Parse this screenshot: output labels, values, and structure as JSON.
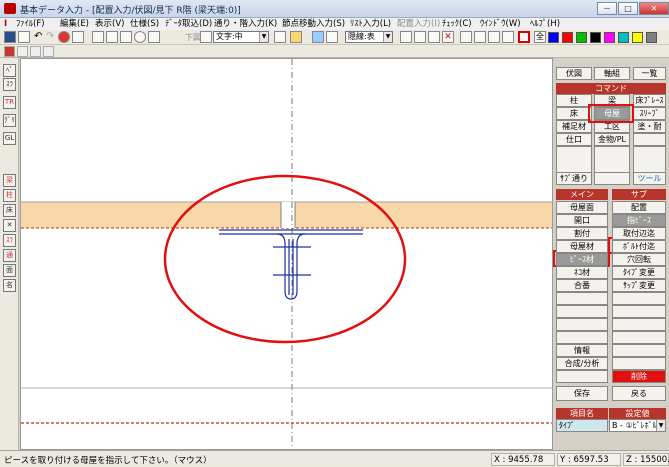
{
  "window": {
    "title": "基本データ入力 - [配置入力/伏図/見下 R階 (梁天端:0)]",
    "min": "－",
    "max": "□",
    "close": "✕"
  },
  "menu": [
    {
      "label": "ﾌｧｲﾙ(F)",
      "enabled": true
    },
    {
      "label": "編集(E)",
      "enabled": true
    },
    {
      "label": "表示(V)",
      "enabled": true
    },
    {
      "label": "仕様(S)",
      "enabled": true
    },
    {
      "label": "ﾃﾞｰﾀ取込(D)",
      "enabled": true
    },
    {
      "label": "通り・階入力(K)",
      "enabled": true
    },
    {
      "label": "節点移動入力(S)",
      "enabled": true
    },
    {
      "label": "ﾘｽﾄ入力(L)",
      "enabled": true
    },
    {
      "label": "配置入力(I)",
      "enabled": false
    },
    {
      "label": "ﾁｪｯｸ(C)",
      "enabled": true
    },
    {
      "label": "ｳｲﾝﾄﾞｳ(W)",
      "enabled": true
    },
    {
      "label": "ﾍﾙﾌﾟ(H)",
      "enabled": true
    }
  ],
  "toolbar": {
    "level_label": "下図",
    "text_size": "文字:中",
    "hidden_line": "隠線:表",
    "all_label": "全",
    "swatches": [
      "#0000ff",
      "#ff0000",
      "#00c000",
      "#000000",
      "#ff00ff",
      "#00c0c0",
      "#ffff00",
      "#808080"
    ]
  },
  "left_tools": [
    "ﾍﾟ",
    "ｽﾗ",
    "TR",
    "ｸﾞﾘ",
    "GL",
    "梁",
    "柱",
    "床",
    "✕",
    "ｽﾗ",
    "通",
    "面",
    "名"
  ],
  "right_panel": {
    "top_tabs": [
      "伏図",
      "軸組",
      "一覧"
    ],
    "command_header": "コマンド",
    "commands": [
      [
        "柱",
        "梁",
        "床ﾌﾞﾚｰｽ"
      ],
      [
        "床",
        "母屋",
        "ｽﾘｰﾌﾞ"
      ],
      [
        "補足材",
        "工区",
        "塗・耐"
      ],
      [
        "仕口",
        "金物/PL",
        ""
      ],
      [
        "",
        "",
        ""
      ],
      [
        "ｻﾌﾞ通り",
        "",
        "ツール"
      ]
    ],
    "main_header": "メイン",
    "sub_header": "サブ",
    "main_items": [
      "母屋面",
      "開口",
      "割付",
      "母屋材",
      "ﾋﾟｰｽ材",
      "ﾈｺ材",
      "合番",
      "",
      "",
      "",
      "",
      "情報",
      "合成/分析",
      ""
    ],
    "sub_items": [
      "配置",
      "指ﾋﾟｰｽ",
      "取付辺迄",
      "ﾎﾞﾙﾄ付迄",
      "穴回転",
      "ﾀｲﾌﾟ変更",
      "ｻｯﾌﾟ変更",
      "",
      "",
      "",
      "",
      "",
      "",
      "削除"
    ],
    "save": "保存",
    "back": "戻る",
    "prop_headers": [
      "項目名",
      "設定値"
    ],
    "prop_row_name": "ﾀｲﾌﾟ",
    "prop_row_value": "B - ①ﾋﾟﾚﾎﾞﾙﾄ2"
  },
  "status": {
    "message": "ピースを取り付ける母屋を指示して下さい。（マウス）",
    "x": "X : 9455.78",
    "y": "Y : 6597.53",
    "z": "Z : 15500."
  }
}
